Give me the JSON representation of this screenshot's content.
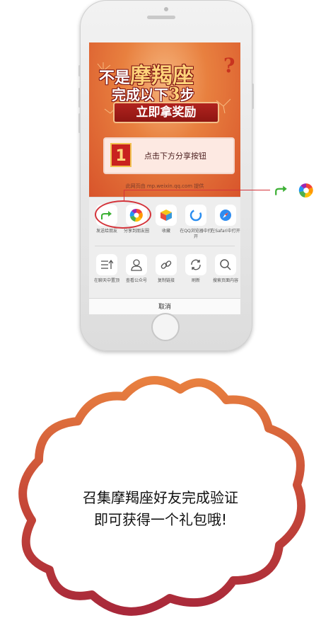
{
  "poster": {
    "title_line1_pre": "不是",
    "title_line1_big": "摩羯座",
    "title_line1_mark": "?",
    "title_line2_pre": "完成以下",
    "title_line2_big": "3",
    "title_line2_post": "步",
    "title_line3": "立即拿奖励",
    "step_number": "1",
    "step_text": "点击下方分享按钮",
    "source_text": "此网页由 mp.weixin.qq.com 提供"
  },
  "share_sheet": {
    "row1": [
      {
        "label": "发送给朋友",
        "icon": "forward-icon"
      },
      {
        "label": "分享到朋友圈",
        "icon": "moments-icon"
      },
      {
        "label": "收藏",
        "icon": "favorite-cube-icon"
      },
      {
        "label": "在QQ浏览器中打开",
        "icon": "qq-browser-icon"
      },
      {
        "label": "在Safari中打开",
        "icon": "safari-compass-icon"
      }
    ],
    "row2": [
      {
        "label": "在聊天中置顶",
        "icon": "pin-top-icon"
      },
      {
        "label": "查看公众号",
        "icon": "profile-icon"
      },
      {
        "label": "复制链接",
        "icon": "link-icon"
      },
      {
        "label": "刷新",
        "icon": "refresh-icon"
      },
      {
        "label": "搜索页面内容",
        "icon": "search-icon"
      }
    ],
    "cancel_label": "取消"
  },
  "callout": {
    "line1": "召集摩羯座好友完成验证",
    "line2": "即可获得一个礼包哦!"
  },
  "colors": {
    "accent_red": "#d4333a",
    "wechat_green": "#3cb034",
    "poster_orange": "#e8803f",
    "cloud_gradient_top": "#e8803f",
    "cloud_gradient_bottom": "#a8283a"
  }
}
